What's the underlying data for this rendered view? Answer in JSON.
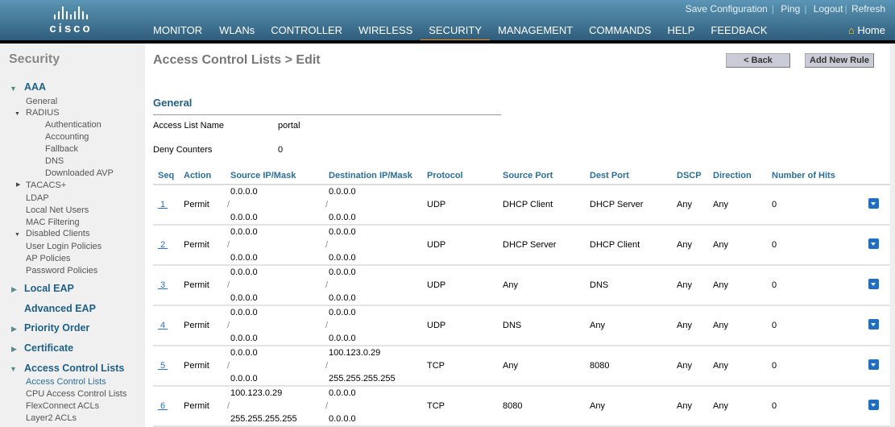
{
  "header": {
    "logo": "cisco",
    "top_links": [
      "Save Configuration",
      "Ping",
      "Logout",
      "Refresh"
    ],
    "nav": [
      "MONITOR",
      "WLANs",
      "CONTROLLER",
      "WIRELESS",
      "SECURITY",
      "MANAGEMENT",
      "COMMANDS",
      "HELP",
      "FEEDBACK"
    ],
    "active_nav": "SECURITY",
    "home": "Home"
  },
  "sidebar": {
    "title": "Security",
    "aaa": "AAA",
    "general": "General",
    "radius": "RADIUS",
    "radius_items": [
      "Authentication",
      "Accounting",
      "Fallback",
      "DNS",
      "Downloaded AVP"
    ],
    "tacacs": "TACACS+",
    "aaa_items": [
      "LDAP",
      "Local Net Users",
      "MAC Filtering"
    ],
    "disabled": "Disabled Clients",
    "aaa_items2": [
      "User Login Policies",
      "AP Policies",
      "Password Policies"
    ],
    "sections": [
      "Local EAP",
      "Advanced EAP",
      "Priority Order",
      "Certificate",
      "Access Control Lists"
    ],
    "acl_items": [
      "Access Control Lists",
      "CPU Access Control Lists",
      "FlexConnect ACLs",
      "Layer2 ACLs"
    ]
  },
  "main": {
    "title": "Access Control Lists > Edit",
    "back": "< Back",
    "add_rule": "Add New Rule",
    "general": "General",
    "acl_name_label": "Access List Name",
    "acl_name": "portal",
    "deny_label": "Deny Counters",
    "deny": "0",
    "columns": [
      "Seq",
      "Action",
      "Source IP/Mask",
      "Destination IP/Mask",
      "Protocol",
      "Source Port",
      "Dest Port",
      "DSCP",
      "Direction",
      "Number of Hits"
    ],
    "rows": [
      {
        "seq": "1",
        "action": "Permit",
        "src_ip": "0.0.0.0",
        "src_mask": "0.0.0.0",
        "dst_ip": "0.0.0.0",
        "dst_mask": "0.0.0.0",
        "proto": "UDP",
        "sport": "DHCP Client",
        "dport": "DHCP Server",
        "dscp": "Any",
        "dir": "Any",
        "hits": "0"
      },
      {
        "seq": "2",
        "action": "Permit",
        "src_ip": "0.0.0.0",
        "src_mask": "0.0.0.0",
        "dst_ip": "0.0.0.0",
        "dst_mask": "0.0.0.0",
        "proto": "UDP",
        "sport": "DHCP Server",
        "dport": "DHCP Client",
        "dscp": "Any",
        "dir": "Any",
        "hits": "0"
      },
      {
        "seq": "3",
        "action": "Permit",
        "src_ip": "0.0.0.0",
        "src_mask": "0.0.0.0",
        "dst_ip": "0.0.0.0",
        "dst_mask": "0.0.0.0",
        "proto": "UDP",
        "sport": "Any",
        "dport": "DNS",
        "dscp": "Any",
        "dir": "Any",
        "hits": "0"
      },
      {
        "seq": "4",
        "action": "Permit",
        "src_ip": "0.0.0.0",
        "src_mask": "0.0.0.0",
        "dst_ip": "0.0.0.0",
        "dst_mask": "0.0.0.0",
        "proto": "UDP",
        "sport": "DNS",
        "dport": "Any",
        "dscp": "Any",
        "dir": "Any",
        "hits": "0"
      },
      {
        "seq": "5",
        "action": "Permit",
        "src_ip": "0.0.0.0",
        "src_mask": "0.0.0.0",
        "dst_ip": "100.123.0.29",
        "dst_mask": "255.255.255.255",
        "proto": "TCP",
        "sport": "Any",
        "dport": "8080",
        "dscp": "Any",
        "dir": "Any",
        "hits": "0"
      },
      {
        "seq": "6",
        "action": "Permit",
        "src_ip": "100.123.0.29",
        "src_mask": "255.255.255.255",
        "dst_ip": "0.0.0.0",
        "dst_mask": "0.0.0.0",
        "proto": "TCP",
        "sport": "8080",
        "dport": "Any",
        "dscp": "Any",
        "dir": "Any",
        "hits": "0"
      }
    ]
  }
}
